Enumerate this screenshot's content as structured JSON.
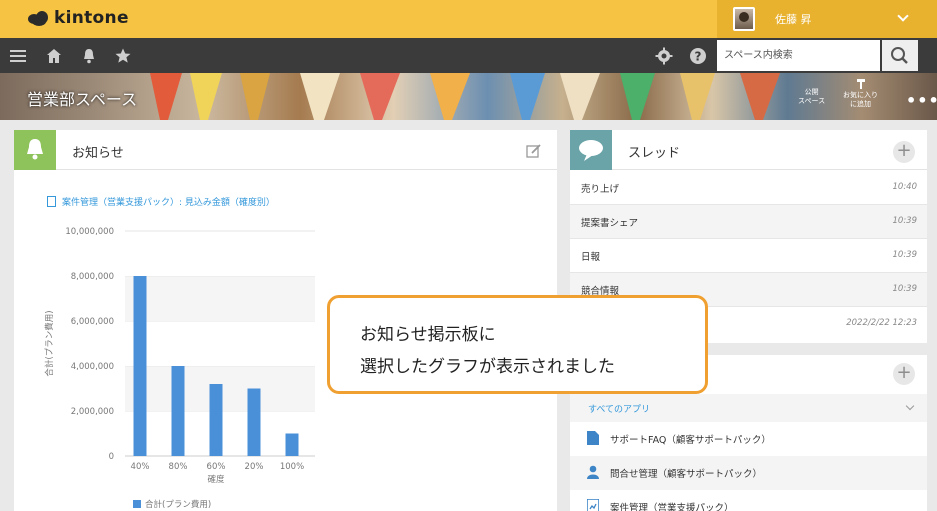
{
  "header": {
    "app_name": "kintone",
    "user_name": "佐藤 昇"
  },
  "toolbar": {
    "icons": [
      "menu-icon",
      "home-icon",
      "bell-icon",
      "star-icon",
      "gear-icon",
      "help-icon",
      "search-icon"
    ],
    "search_placeholder": "スペース内検索"
  },
  "space": {
    "title": "営業部スペース",
    "public_label": "公開\nスペース",
    "favorite_label": "お気に入り\nに追加",
    "more_label": "•••"
  },
  "notice": {
    "title": "お知らせ",
    "chart_link": "案件管理（営業支援パック）: 見込み金額（確度別）"
  },
  "chart_data": {
    "type": "bar",
    "categories": [
      "40%",
      "80%",
      "60%",
      "20%",
      "100%"
    ],
    "values": [
      8000000,
      4000000,
      3200000,
      3000000,
      1000000
    ],
    "ylabel": "合計(プラン費用)",
    "xlabel": "確度",
    "ylim": [
      0,
      10000000
    ],
    "yticks": [
      "0",
      "2,000,000",
      "4,000,000",
      "6,000,000",
      "8,000,000",
      "10,000,000"
    ],
    "legend": "合計(プラン費用)",
    "color": "#4a90d9"
  },
  "threads": {
    "title": "スレッド",
    "items": [
      {
        "name": "売り上げ",
        "time": "10:40"
      },
      {
        "name": "提案書シェア",
        "time": "10:39"
      },
      {
        "name": "日報",
        "time": "10:39"
      },
      {
        "name": "競合情報",
        "time": "10:39"
      },
      {
        "name": "",
        "time": "2022/2/22 12:23"
      }
    ]
  },
  "apps": {
    "filter_label": "すべてのアプリ",
    "items": [
      {
        "name": "サポートFAQ（顧客サポートパック）"
      },
      {
        "name": "問合せ管理（顧客サポートパック）"
      },
      {
        "name": "案件管理（営業支援パック）"
      }
    ]
  },
  "callout": {
    "line1": "お知らせ掲示板に",
    "line2": "選択したグラフが表示されました"
  },
  "colors": {
    "header_yellow": "#f6c342",
    "toolbar_dark": "#3b3b3b",
    "notice_green": "#8ec25b",
    "thread_teal": "#6aa3a8",
    "link_blue": "#3498db",
    "callout_orange": "#f0a030"
  }
}
